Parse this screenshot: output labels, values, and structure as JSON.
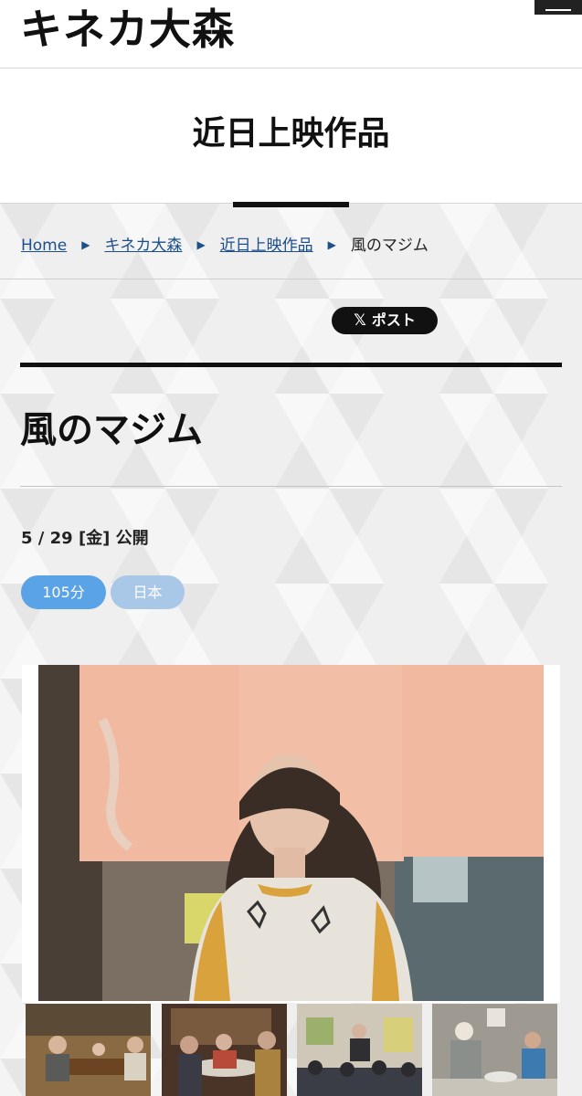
{
  "header": {
    "logo_text": "キネカ大森",
    "menu_icon": "hamburger-menu-icon"
  },
  "page_title": "近日上映作品",
  "breadcrumb": {
    "home": "Home",
    "theater": "キネカ大森",
    "section": "近日上映作品",
    "current": "風のマジム",
    "separator": "▶"
  },
  "share": {
    "icon": "x-logo-icon",
    "x_glyph": "𝕏",
    "label": "ポスト"
  },
  "film": {
    "title": "風のマジム",
    "release": "5 / 29 [金] 公開",
    "tags": {
      "runtime": "105分",
      "country": "日本"
    }
  },
  "colors": {
    "link": "#1c4f8a",
    "tag_runtime": "#5aa3e6",
    "tag_country": "#a9c8e8",
    "share_bg": "#111111"
  }
}
